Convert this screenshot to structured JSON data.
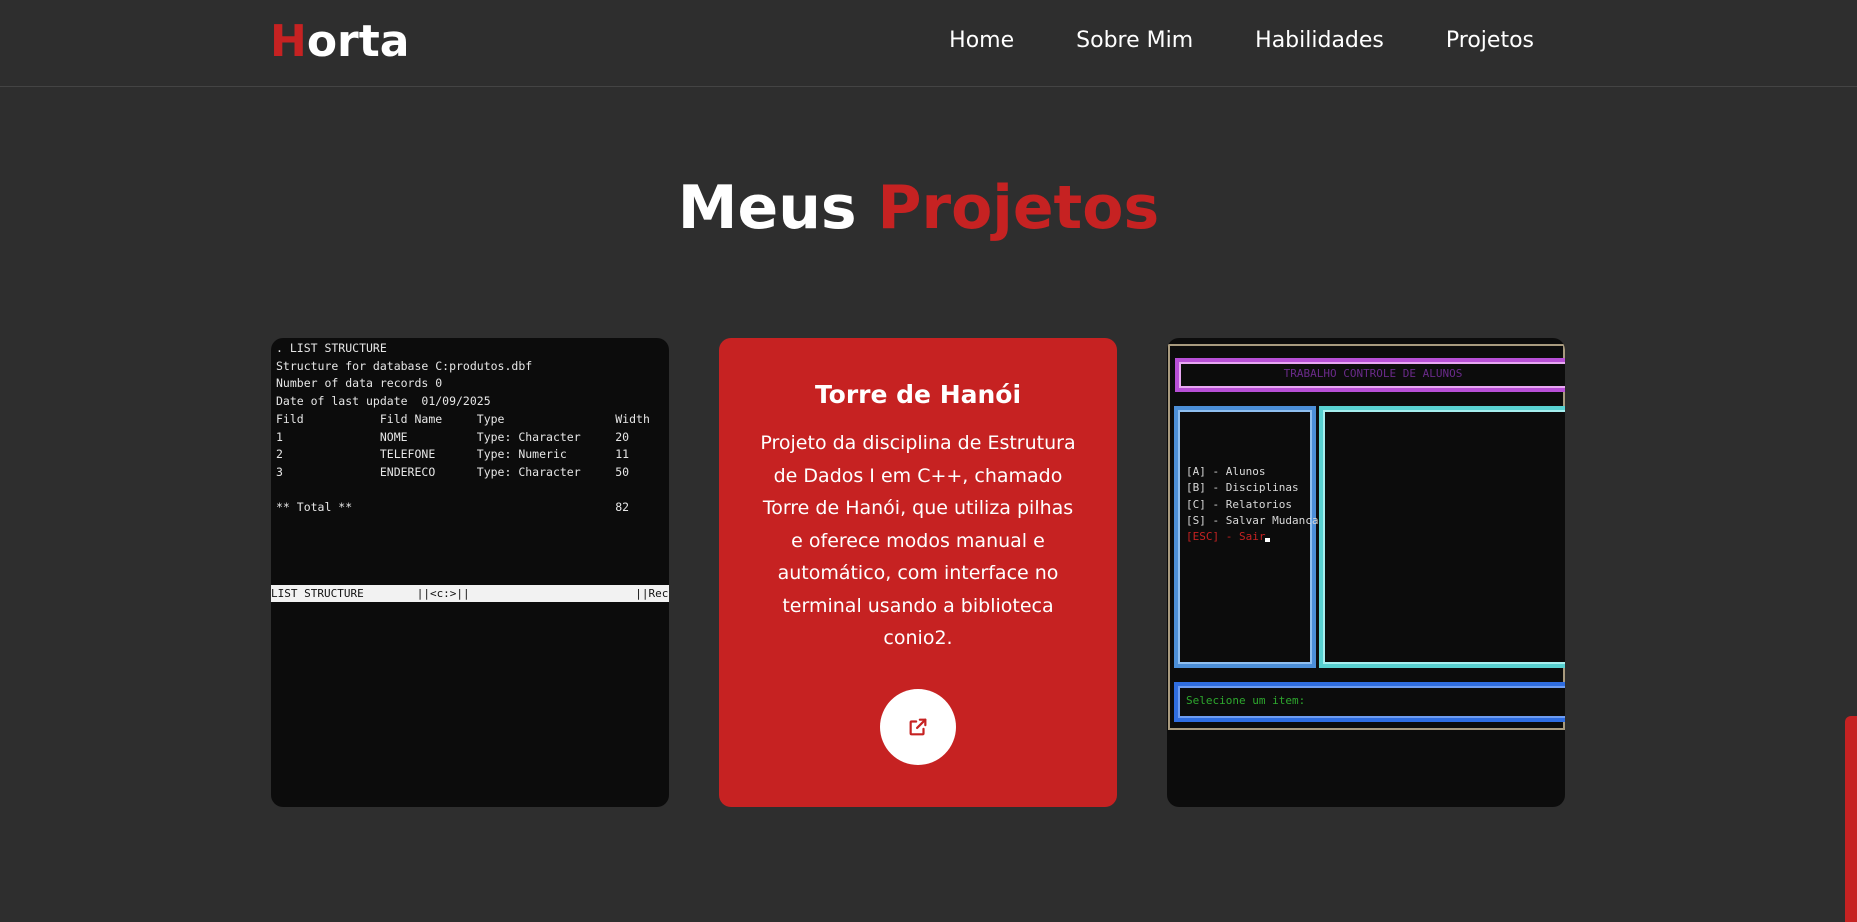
{
  "header": {
    "logo_first": "H",
    "logo_rest": "orta",
    "nav": [
      "Home",
      "Sobre Mim",
      "Habilidades",
      "Projetos"
    ]
  },
  "section": {
    "title_part1": "Meus",
    "title_part2": "Projetos"
  },
  "cards": [
    {
      "terminal_lines": ". LIST STRUCTURE\nStructure for database C:produtos.dbf\nNumber of data records 0\nDate of last update  01/09/2025\nFild           Fild Name     Type                Width\n1              NOME          Type: Character     20\n2              TELEFONE      Type: Numeric       11\n3              ENDERECO      Type: Character     50\n\n** Total **                                      82",
      "status_bar": "LIST STRUCTURE        ||<c:>||                         ||Rec"
    },
    {
      "title": "Torre de Hanói",
      "description": "Projeto da disciplina de Estrutura de Dados I em C++, chamado Torre de Hanói, que utiliza pilhas e oferece modos manual e automático, com interface no terminal usando a biblioteca conio2.",
      "link_icon": "external-link-icon"
    },
    {
      "app_title": "TRABALHO CONTROLE DE ALUNOS",
      "menu": [
        "[A] - Alunos",
        "[B] - Disciplinas",
        "[C] - Relatorios",
        "[S] - Salvar Mudancas"
      ],
      "menu_exit": "[ESC] - Sair",
      "prompt": "Selecione um item:"
    }
  ],
  "colors": {
    "accent": "#c62222",
    "background": "#2e2e2e"
  }
}
